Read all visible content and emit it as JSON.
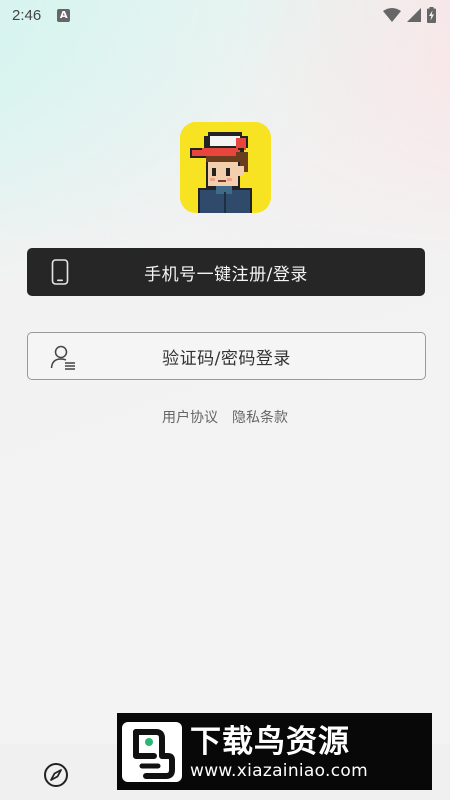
{
  "status_bar": {
    "time": "2:46",
    "notification_icon": "a-icon",
    "wifi_icon": "wifi-icon",
    "signal_icon": "signal-icon",
    "battery_icon": "battery-charging-icon"
  },
  "logo": {
    "icon": "pixel-boy-avatar-icon",
    "background_color": "#f8e323"
  },
  "login": {
    "phone_button_label": "手机号一键注册/登录",
    "phone_icon": "phone-icon",
    "code_button_label": "验证码/密码登录",
    "code_icon": "user-list-icon"
  },
  "agreements": {
    "user_agreement": "用户协议",
    "privacy_policy": "隐私条款"
  },
  "bottom_bar": {
    "compass_icon": "compass-icon"
  },
  "watermark": {
    "title": "下载鸟资源",
    "url": "www.xiazainiao.com"
  }
}
